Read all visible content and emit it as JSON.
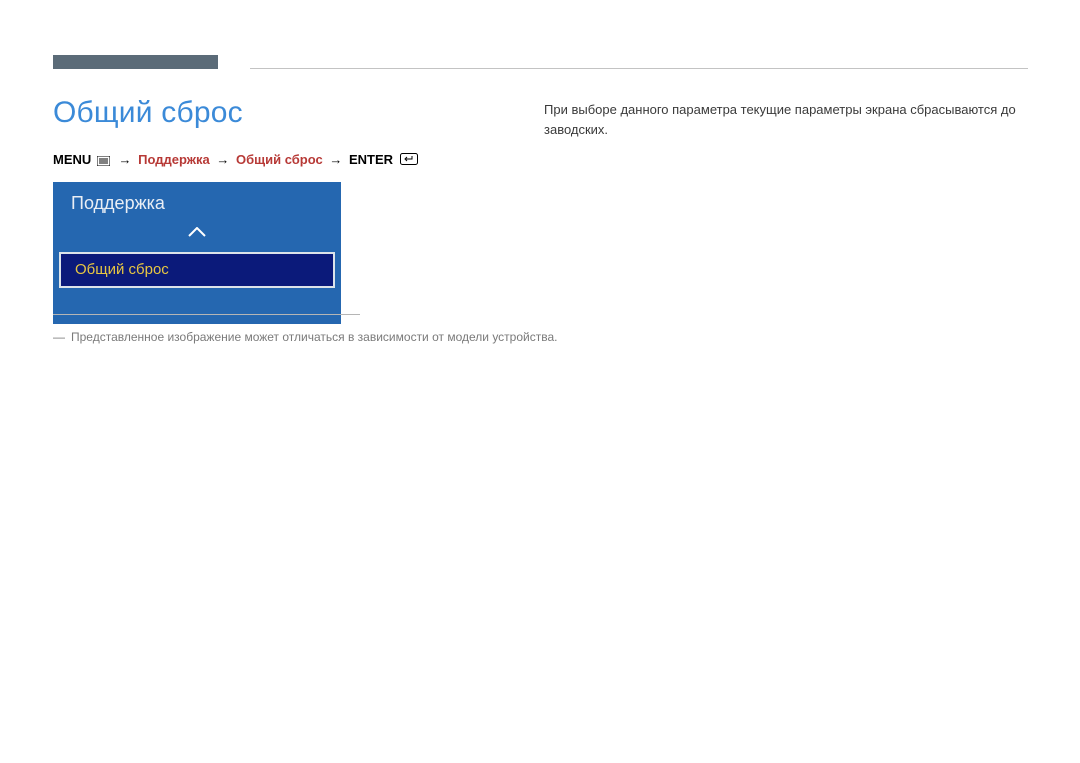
{
  "page_title": "Общий сброс",
  "breadcrumb": {
    "menu_label": "MENU",
    "arrow": "→",
    "path1": "Поддержка",
    "path2": "Общий сброс",
    "enter_label": "ENTER"
  },
  "description": "При выборе данного параметра текущие параметры экрана сбрасываются до заводских.",
  "menu_panel": {
    "header": "Поддержка",
    "selected_item": "Общий сброс"
  },
  "disclaimer": "Представленное изображение может отличаться в зависимости от модели устройства."
}
